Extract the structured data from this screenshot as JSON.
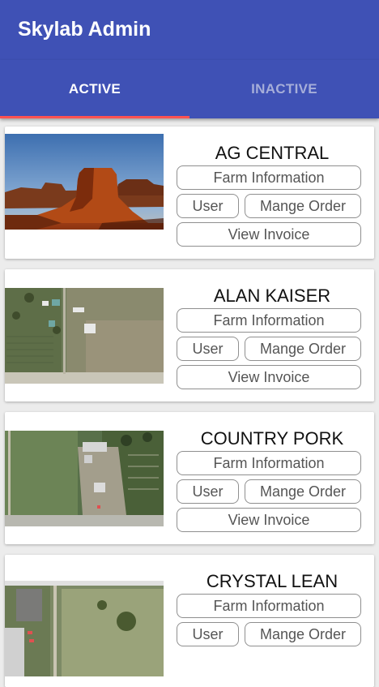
{
  "app": {
    "title": "Skylab Admin"
  },
  "tabs": [
    {
      "label": "ACTIVE",
      "selected": true
    },
    {
      "label": "INACTIVE",
      "selected": false
    }
  ],
  "colors": {
    "primary": "#3f51b5",
    "indicator": "#ff5252",
    "inactive_tab": "#a6aed9"
  },
  "farms": [
    {
      "name": "AG CENTRAL",
      "image": "desert-butte-photo",
      "farm_info_label": "Farm Information",
      "user_label": "User",
      "manage_order_label": "Mange Order",
      "view_invoice_label": "View Invoice"
    },
    {
      "name": "ALAN KAISER",
      "image": "aerial-farm-photo",
      "farm_info_label": "Farm Information",
      "user_label": "User",
      "manage_order_label": "Mange Order",
      "view_invoice_label": "View Invoice"
    },
    {
      "name": "COUNTRY PORK",
      "image": "aerial-farm-photo",
      "farm_info_label": "Farm Information",
      "user_label": "User",
      "manage_order_label": "Mange Order",
      "view_invoice_label": "View Invoice"
    },
    {
      "name": "CRYSTAL LEAN",
      "image": "aerial-farm-photo",
      "farm_info_label": "Farm Information",
      "user_label": "User",
      "manage_order_label": "Mange Order"
    }
  ]
}
